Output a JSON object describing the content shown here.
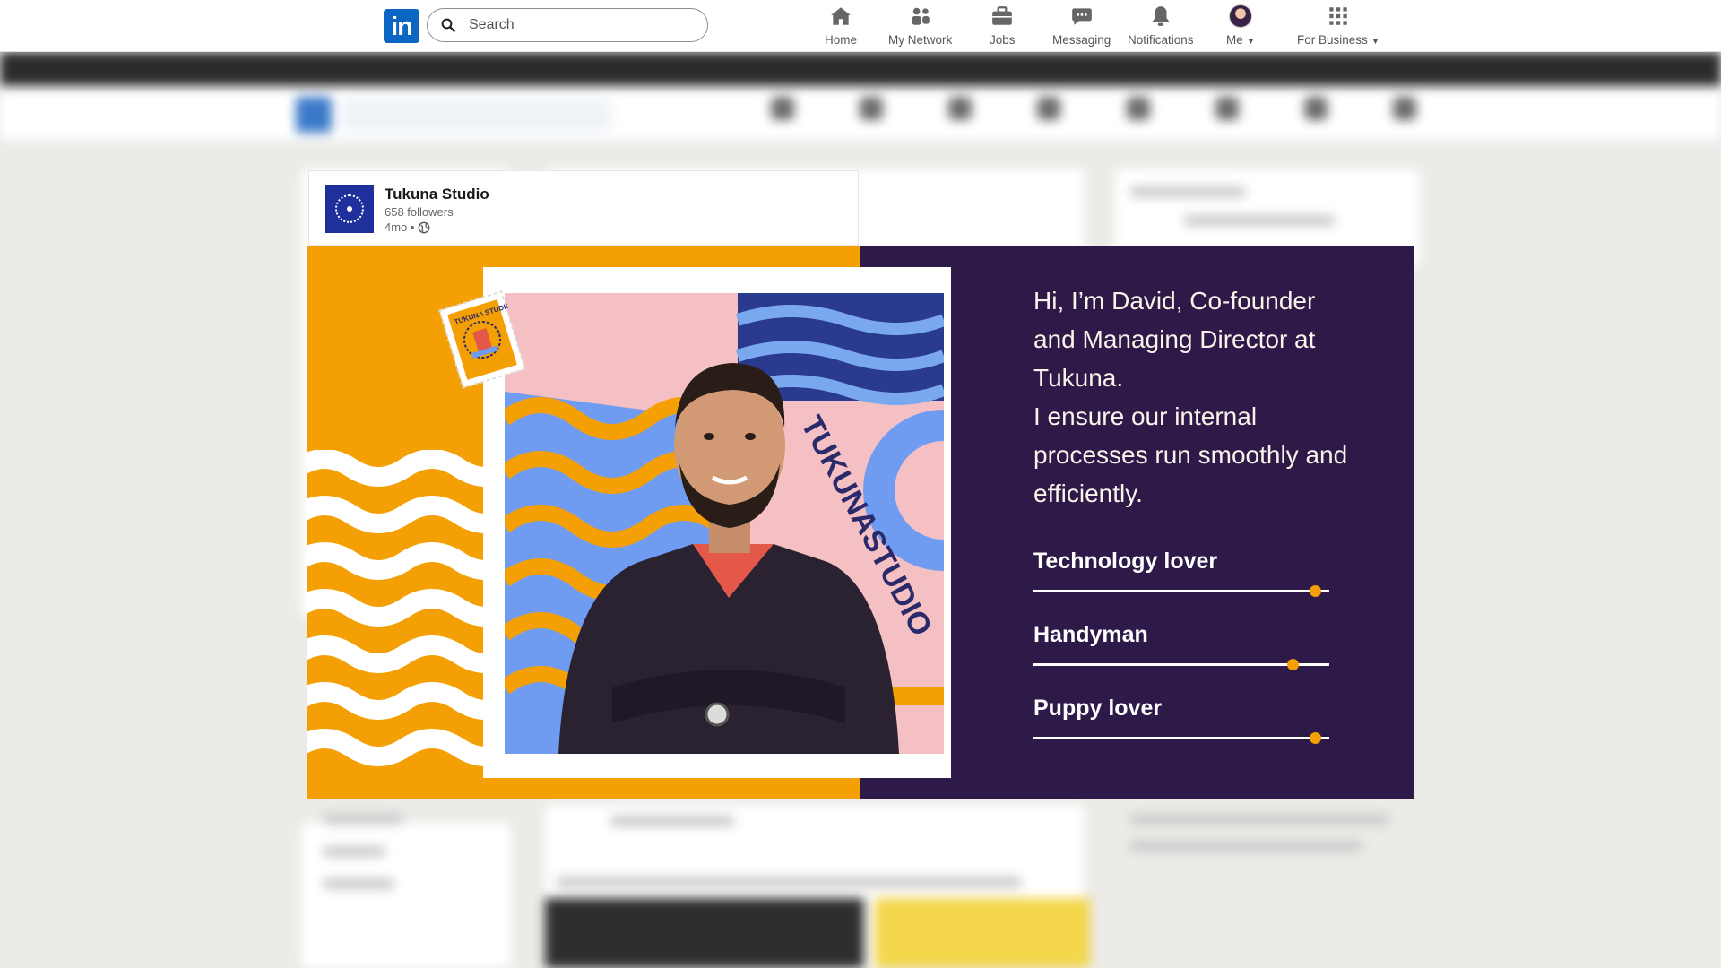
{
  "nav": {
    "search_placeholder": "Search",
    "items": [
      {
        "label": "Home",
        "icon": "home-icon"
      },
      {
        "label": "My Network",
        "icon": "network-icon"
      },
      {
        "label": "Jobs",
        "icon": "briefcase-icon"
      },
      {
        "label": "Messaging",
        "icon": "chat-icon"
      },
      {
        "label": "Notifications",
        "icon": "bell-icon"
      },
      {
        "label": "Me",
        "icon": "avatar"
      },
      {
        "label": "For Business",
        "icon": "grid-icon"
      }
    ]
  },
  "post": {
    "author": "Tukuna Studio",
    "followers": "658 followers",
    "time": "4mo •"
  },
  "image": {
    "bio_lines": [
      "Hi, I’m David, Co-founder",
      "and Managing Director at",
      "Tukuna.",
      "I ensure our internal",
      "processes run smoothly and",
      "efficiently."
    ],
    "traits": [
      {
        "label": "Technology lover",
        "level": 1.0
      },
      {
        "label": "Handyman",
        "level": 0.92
      },
      {
        "label": "Puppy lover",
        "level": 1.0
      }
    ],
    "wall_text": "TUKUNASTUDIO",
    "stamp_text": "TUKUNA STUDIO"
  },
  "colors": {
    "linkedin_blue": "#0a66c2",
    "orange": "#f4a005",
    "purple": "#2d1a49",
    "brand_blue": "#1f2f9c"
  }
}
